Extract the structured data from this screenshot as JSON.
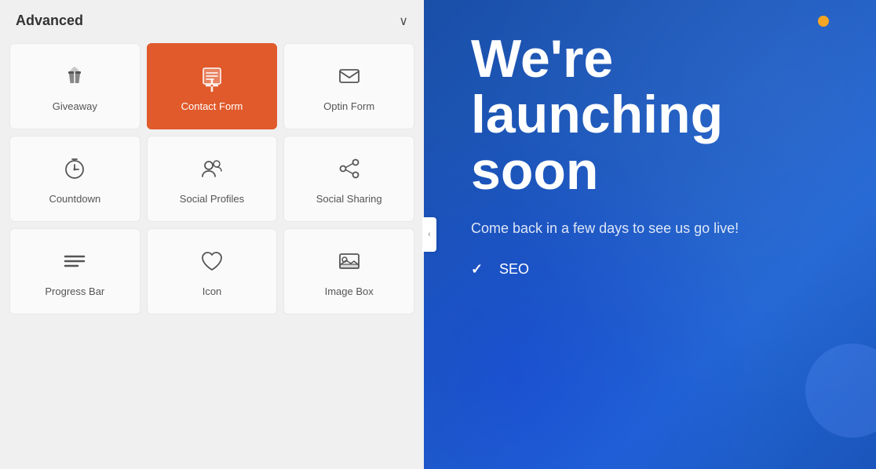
{
  "panel": {
    "title": "Advanced",
    "chevron": "∨",
    "collapse_arrow": "‹"
  },
  "widgets": [
    {
      "id": "giveaway",
      "label": "Giveaway",
      "icon": "shield",
      "active": false
    },
    {
      "id": "contact-form",
      "label": "Contact Form",
      "icon": "form",
      "active": true
    },
    {
      "id": "optin-form",
      "label": "Optin Form",
      "icon": "mail",
      "active": false
    },
    {
      "id": "countdown",
      "label": "Countdown",
      "icon": "timer",
      "active": false
    },
    {
      "id": "social-profiles",
      "label": "Social Profiles",
      "icon": "people",
      "active": false
    },
    {
      "id": "social-sharing",
      "label": "Social Sharing",
      "icon": "share",
      "active": false
    },
    {
      "id": "progress-bar",
      "label": "Progress Bar",
      "icon": "bars",
      "active": false
    },
    {
      "id": "icon",
      "label": "Icon",
      "icon": "heart",
      "active": false
    },
    {
      "id": "image-box",
      "label": "Image Box",
      "icon": "image",
      "active": false
    }
  ],
  "hero": {
    "title": "We're launching soon",
    "subtitle": "Come back in a few days to see us go live!",
    "features": [
      "SEO",
      ""
    ]
  },
  "colors": {
    "active_bg": "#e05a2b",
    "panel_bg": "#f0f0f0",
    "hero_bg_start": "#1a4fa8",
    "hero_bg_end": "#2266d4"
  }
}
